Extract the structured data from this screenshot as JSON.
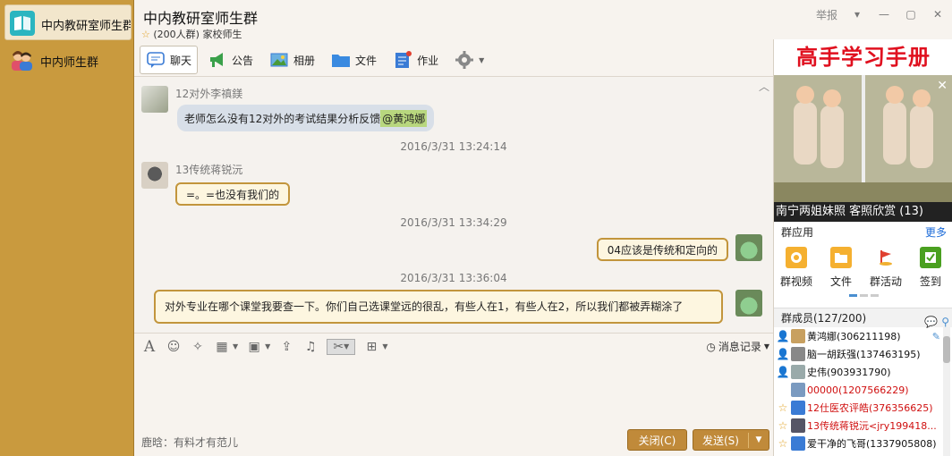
{
  "sidebar": {
    "items": [
      {
        "label": "中内教研室师生群",
        "selected": true
      },
      {
        "label": "中内师生群",
        "selected": false
      }
    ]
  },
  "header": {
    "title": "中内教研室师生群",
    "member_count": "(200人群)",
    "group_type": "家校师生",
    "report": "举报"
  },
  "tabs": [
    {
      "label": "聊天",
      "icon": "chat-icon"
    },
    {
      "label": "公告",
      "icon": "announcement-icon"
    },
    {
      "label": "相册",
      "icon": "album-icon"
    },
    {
      "label": "文件",
      "icon": "folder-icon"
    },
    {
      "label": "作业",
      "icon": "homework-icon"
    }
  ],
  "messages": [
    {
      "sender": "12对外李禛鎂",
      "text_before": "老师怎么没有12对外的考试结果分析反馈",
      "mention": "@黄鸿娜"
    },
    {
      "timestamp": "2016/3/31 13:24:14"
    },
    {
      "sender": "13传统蒋锐沅",
      "text": "=。=也没有我们的"
    },
    {
      "timestamp": "2016/3/31 13:34:29"
    },
    {
      "text": "04应该是传统和定向的"
    },
    {
      "timestamp": "2016/3/31 13:36:04"
    },
    {
      "text": "对外专业在哪个课堂我要查一下。你们自己选课堂远的很乱，有些人在1，有些人在2，所以我们都被弄糊涂了"
    }
  ],
  "input_toolbar": {
    "history_label": "消息记录"
  },
  "input": {
    "signature": "鹿晗：有料才有范儿",
    "close_label": "关闭(C)",
    "send_label": "发送(S)"
  },
  "right_panel": {
    "ad_title": "高手学习手册",
    "ad_caption": "南宁两姐妹照 客照欣赏 (13)",
    "apps_header": "群应用",
    "apps_more": "更多",
    "apps": [
      {
        "label": "群视频",
        "color": "#f0a020"
      },
      {
        "label": "文件",
        "color": "#f0a020"
      },
      {
        "label": "群活动",
        "color": "#e04030"
      },
      {
        "label": "签到",
        "color": "#4aa020"
      }
    ],
    "members_header": "群成员(127/200)",
    "members": [
      {
        "name": "黄鸿娜(306211198)",
        "color": "#111",
        "badge": "owner-icon"
      },
      {
        "name": "脑一胡跃强(137463195)",
        "color": "#111",
        "badge": "admin-icon"
      },
      {
        "name": "史伟(903931790)",
        "color": "#111",
        "badge": "admin-icon"
      },
      {
        "name": "00000(1207566229)",
        "color": "#d01010",
        "badge": ""
      },
      {
        "name": "12仕医农评皓(376356625)",
        "color": "#d01010",
        "badge": "star-icon"
      },
      {
        "name": "13传统蒋锐沅<jry199418...",
        "color": "#d01010",
        "badge": "star-icon"
      },
      {
        "name": "爱干净的飞哥(1337905808)",
        "color": "#111",
        "badge": "star-icon"
      }
    ]
  }
}
